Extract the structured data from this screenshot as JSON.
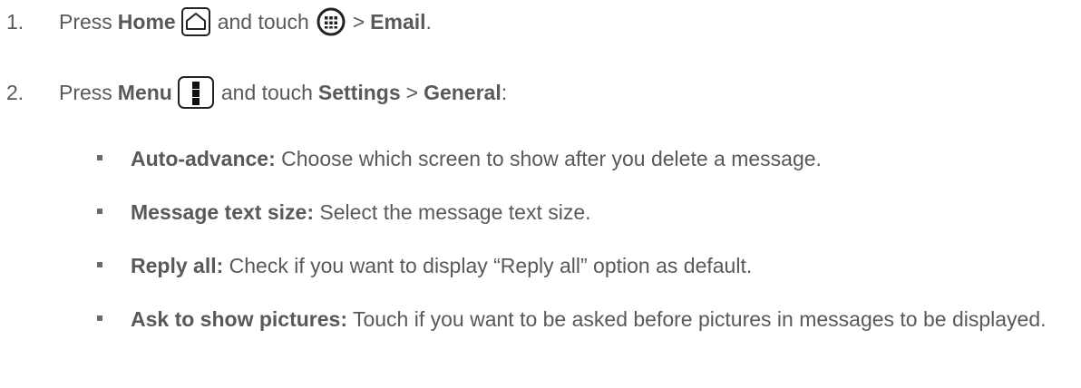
{
  "steps": [
    {
      "number": "1.",
      "press": "Press",
      "button": "Home",
      "and_touch": "and touch",
      "separator": ">",
      "target": "Email",
      "end": ".",
      "icons": [
        "home-button-icon",
        "apps-icon"
      ]
    },
    {
      "number": "2.",
      "press": "Press",
      "button": "Menu",
      "and_touch": "and touch",
      "target1": "Settings",
      "separator": ">",
      "target2": "General",
      "end": ":",
      "icons": [
        "menu-button-icon"
      ]
    }
  ],
  "bullets": [
    {
      "term": "Auto-advance:",
      "text": "Choose which screen to show after you delete a message."
    },
    {
      "term": "Message text size:",
      "text": "Select the message text size."
    },
    {
      "term": "Reply all:",
      "text": "Check if you want to display “Reply all” option as default."
    },
    {
      "term": "Ask to show pictures:",
      "text": "Touch if you want to be asked before pictures in messages to be displayed."
    }
  ]
}
